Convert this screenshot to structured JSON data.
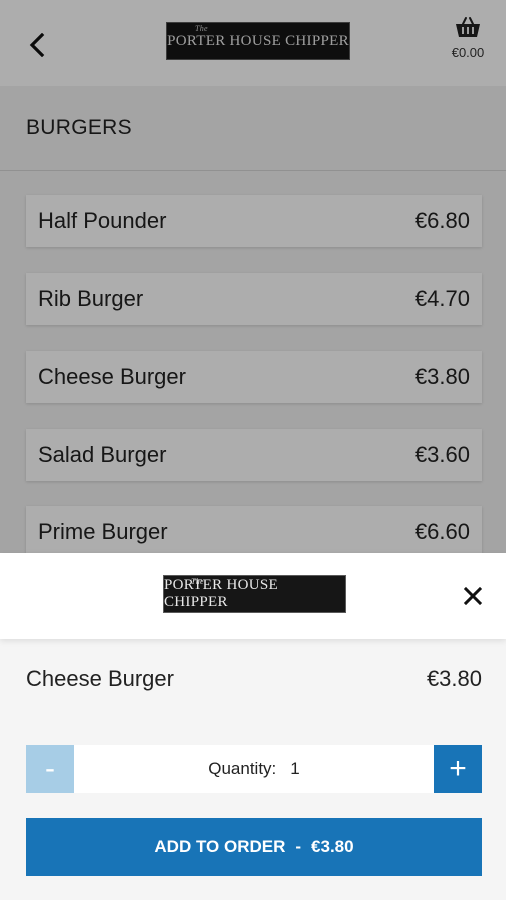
{
  "header": {
    "logo_small": "The",
    "logo_text": "PORTER HOUSE CHIPPER",
    "basket_total": "€0.00"
  },
  "section": {
    "title": "BURGERS"
  },
  "menu_items": [
    {
      "name": "Half Pounder",
      "price": "€6.80"
    },
    {
      "name": "Rib Burger",
      "price": "€4.70"
    },
    {
      "name": "Cheese Burger",
      "price": "€3.80"
    },
    {
      "name": "Salad Burger",
      "price": "€3.60"
    },
    {
      "name": "Prime Burger",
      "price": "€6.60"
    }
  ],
  "sheet": {
    "logo_small": "The",
    "logo_text": "PORTER HOUSE CHIPPER",
    "item_name": "Cheese Burger",
    "item_price": "€3.80",
    "minus_label": "-",
    "plus_label": "+",
    "quantity_label": "Quantity:",
    "quantity_value": "1",
    "add_label": "ADD TO ORDER",
    "add_separator": "-",
    "add_total": "€3.80"
  },
  "icons": {
    "back": "chevron-left-icon",
    "basket": "basket-icon",
    "close": "close-icon"
  },
  "colors": {
    "accent": "#1874b7",
    "accent_disabled": "#a7cde6",
    "logo_bg": "#161616"
  }
}
